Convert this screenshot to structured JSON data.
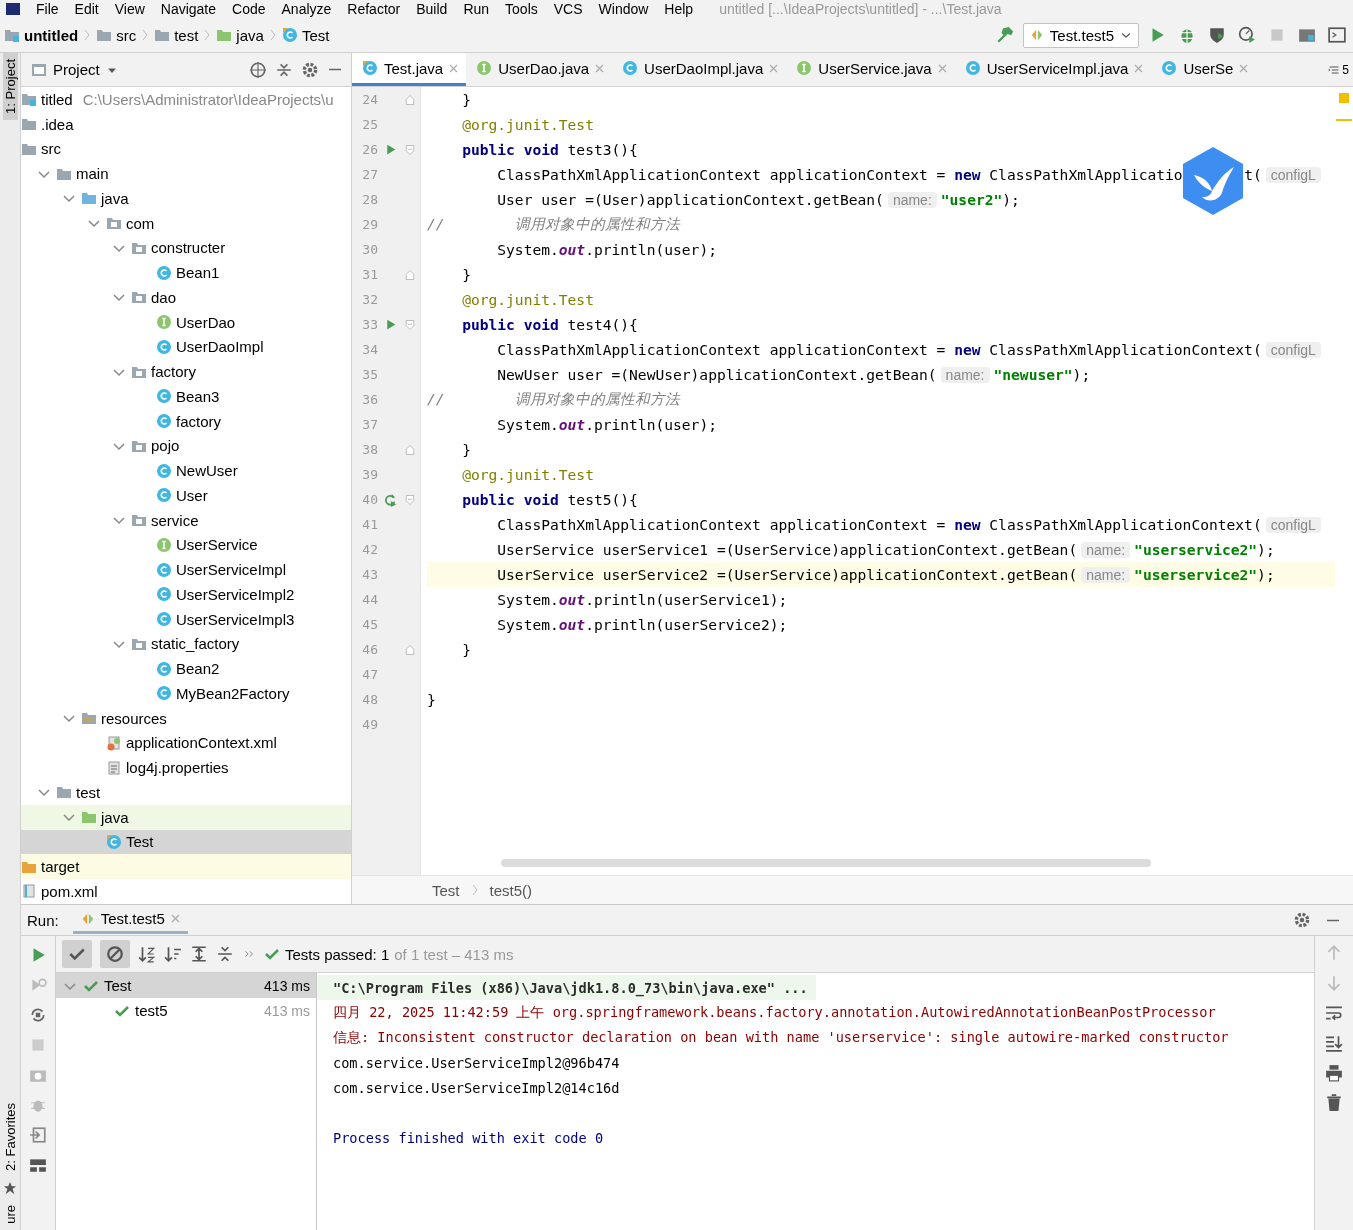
{
  "menu_bar": {
    "items": [
      "File",
      "Edit",
      "View",
      "Navigate",
      "Code",
      "Analyze",
      "Refactor",
      "Build",
      "Run",
      "Tools",
      "VCS",
      "Window",
      "Help"
    ],
    "title": "untitled [...\\IdeaProjects\\untitled] - ...\\Test.java"
  },
  "nav_bar": {
    "breadcrumbs": [
      {
        "label": "untitled",
        "kind": "module"
      },
      {
        "label": "src",
        "kind": "folder"
      },
      {
        "label": "test",
        "kind": "folder"
      },
      {
        "label": "java",
        "kind": "test-folder"
      },
      {
        "label": "Test",
        "kind": "test-class"
      }
    ],
    "run_config": "Test.test5"
  },
  "side_stripe": {
    "top": "1: Project",
    "bottom": "2: Favorites",
    "cut": "ure"
  },
  "project_panel": {
    "title": "Project",
    "tree": [
      {
        "label": "titled",
        "path": "C:\\Users\\Administrator\\IdeaProjects\\u",
        "kind": "module",
        "expanded": true,
        "selected": false,
        "children": [
          {
            "label": ".idea",
            "kind": "folder",
            "selected": false
          },
          {
            "label": "src",
            "kind": "folder",
            "expanded": true,
            "selected": false,
            "children": [
              {
                "label": "main",
                "kind": "folder",
                "expanded": true,
                "selected": false,
                "children": [
                  {
                    "label": "java",
                    "kind": "source-folder",
                    "expanded": true,
                    "selected": false,
                    "children": [
                      {
                        "label": "com",
                        "kind": "package",
                        "expanded": true,
                        "selected": false,
                        "children": [
                          {
                            "label": "constructer",
                            "kind": "package",
                            "expanded": true,
                            "selected": false,
                            "children": [
                              {
                                "label": "Bean1",
                                "kind": "class",
                                "selected": false
                              }
                            ]
                          },
                          {
                            "label": "dao",
                            "kind": "package",
                            "expanded": true,
                            "selected": false,
                            "children": [
                              {
                                "label": "UserDao",
                                "kind": "interface",
                                "selected": false
                              },
                              {
                                "label": "UserDaoImpl",
                                "kind": "class",
                                "selected": false
                              }
                            ]
                          },
                          {
                            "label": "factory",
                            "kind": "package",
                            "expanded": true,
                            "selected": false,
                            "children": [
                              {
                                "label": "Bean3",
                                "kind": "class",
                                "selected": false
                              },
                              {
                                "label": "factory",
                                "kind": "class",
                                "selected": false
                              }
                            ]
                          },
                          {
                            "label": "pojo",
                            "kind": "package",
                            "expanded": true,
                            "selected": false,
                            "children": [
                              {
                                "label": "NewUser",
                                "kind": "class",
                                "selected": false
                              },
                              {
                                "label": "User",
                                "kind": "class",
                                "selected": false
                              }
                            ]
                          },
                          {
                            "label": "service",
                            "kind": "package",
                            "expanded": true,
                            "selected": false,
                            "children": [
                              {
                                "label": "UserService",
                                "kind": "interface",
                                "selected": false
                              },
                              {
                                "label": "UserServiceImpl",
                                "kind": "class",
                                "selected": false
                              },
                              {
                                "label": "UserServiceImpl2",
                                "kind": "class",
                                "selected": false
                              },
                              {
                                "label": "UserServiceImpl3",
                                "kind": "class",
                                "selected": false
                              }
                            ]
                          },
                          {
                            "label": "static_factory",
                            "kind": "package",
                            "expanded": true,
                            "selected": false,
                            "children": [
                              {
                                "label": "Bean2",
                                "kind": "class",
                                "selected": false
                              },
                              {
                                "label": "MyBean2Factory",
                                "kind": "class",
                                "selected": false
                              }
                            ]
                          }
                        ]
                      }
                    ]
                  },
                  {
                    "label": "resources",
                    "kind": "resources-folder",
                    "expanded": true,
                    "selected": false,
                    "children": [
                      {
                        "label": "applicationContext.xml",
                        "kind": "xml",
                        "selected": false
                      },
                      {
                        "label": "log4j.properties",
                        "kind": "properties",
                        "selected": false
                      }
                    ]
                  }
                ]
              },
              {
                "label": "test",
                "kind": "folder",
                "expanded": true,
                "selected": false,
                "children": [
                  {
                    "label": "java",
                    "kind": "test-folder",
                    "expanded": true,
                    "selected": false,
                    "children": [
                      {
                        "label": "Test",
                        "kind": "test-class",
                        "selected": true
                      }
                    ]
                  }
                ]
              }
            ]
          },
          {
            "label": "target",
            "kind": "excluded-folder",
            "selected": false
          },
          {
            "label": "pom.xml",
            "kind": "pom",
            "selected": false
          }
        ]
      }
    ]
  },
  "editor": {
    "tabs": [
      {
        "label": "Test.java",
        "kind": "test-class",
        "selected": true
      },
      {
        "label": "UserDao.java",
        "kind": "interface",
        "selected": false
      },
      {
        "label": "UserDaoImpl.java",
        "kind": "class",
        "selected": false
      },
      {
        "label": "UserService.java",
        "kind": "interface",
        "selected": false
      },
      {
        "label": "UserServiceImpl.java",
        "kind": "class",
        "selected": false
      },
      {
        "label": "UserSe",
        "kind": "class",
        "selected": false
      }
    ],
    "overflow": "5",
    "lines": [
      {
        "number": "24",
        "kind": "member",
        "fold_marker": {
          "kind": "end"
        },
        "current": false,
        "tokens": [
          {
            "kind": "plain",
            "text": "}"
          }
        ]
      },
      {
        "number": "25",
        "kind": "member",
        "current": false,
        "tokens": [
          {
            "kind": "annotation",
            "text": "@org.junit.Test"
          }
        ]
      },
      {
        "number": "26",
        "kind": "member",
        "run_marker": {
          "kind": "run"
        },
        "fold_marker": {
          "kind": "start"
        },
        "current": false,
        "tokens": [
          {
            "kind": "keyword",
            "text": "public void"
          },
          {
            "kind": "plain",
            "text": " test3(){"
          }
        ]
      },
      {
        "number": "27",
        "kind": "body",
        "current": false,
        "tokens": [
          {
            "kind": "plain",
            "text": "ClassPathXmlApplicationContext applicationContext = "
          },
          {
            "kind": "keyword",
            "text": "new"
          },
          {
            "kind": "plain",
            "text": " ClassPathXmlApplicatio"
          },
          {
            "kind": "overlay-gap"
          },
          {
            "kind": "plain",
            "text": "t("
          },
          {
            "kind": "hint",
            "text": "configL"
          }
        ]
      },
      {
        "number": "28",
        "kind": "body",
        "current": false,
        "tokens": [
          {
            "kind": "plain",
            "text": "User user =(User)applicationContext.getBean("
          },
          {
            "kind": "hint",
            "text": "name:"
          },
          {
            "kind": "string",
            "text": "\"user2\""
          },
          {
            "kind": "plain",
            "text": ");"
          }
        ]
      },
      {
        "number": "29",
        "kind": "top",
        "current": false,
        "tokens": [
          {
            "kind": "comment",
            "text": "//        调用对象中的属性和方法"
          }
        ]
      },
      {
        "number": "30",
        "kind": "body",
        "current": false,
        "tokens": [
          {
            "kind": "plain",
            "text": "System."
          },
          {
            "kind": "field",
            "text": "out"
          },
          {
            "kind": "plain",
            "text": ".println(user);"
          }
        ]
      },
      {
        "number": "31",
        "kind": "member",
        "fold_marker": {
          "kind": "end"
        },
        "current": false,
        "tokens": [
          {
            "kind": "plain",
            "text": "}"
          }
        ]
      },
      {
        "number": "32",
        "kind": "member",
        "current": false,
        "tokens": [
          {
            "kind": "annotation",
            "text": "@org.junit.Test"
          }
        ]
      },
      {
        "number": "33",
        "kind": "member",
        "run_marker": {
          "kind": "run"
        },
        "fold_marker": {
          "kind": "start"
        },
        "current": false,
        "tokens": [
          {
            "kind": "keyword",
            "text": "public void"
          },
          {
            "kind": "plain",
            "text": " test4(){"
          }
        ]
      },
      {
        "number": "34",
        "kind": "body",
        "current": false,
        "tokens": [
          {
            "kind": "plain",
            "text": "ClassPathXmlApplicationContext applicationContext = "
          },
          {
            "kind": "keyword",
            "text": "new"
          },
          {
            "kind": "plain",
            "text": " ClassPathXmlApplicationContext("
          },
          {
            "kind": "hint",
            "text": "configL"
          }
        ]
      },
      {
        "number": "35",
        "kind": "body",
        "current": false,
        "tokens": [
          {
            "kind": "plain",
            "text": "NewUser user =(NewUser)applicationContext.getBean("
          },
          {
            "kind": "hint",
            "text": "name:"
          },
          {
            "kind": "string",
            "text": "\"newuser\""
          },
          {
            "kind": "plain",
            "text": ");"
          }
        ]
      },
      {
        "number": "36",
        "kind": "top",
        "current": false,
        "tokens": [
          {
            "kind": "comment",
            "text": "//        调用对象中的属性和方法"
          }
        ]
      },
      {
        "number": "37",
        "kind": "body",
        "current": false,
        "tokens": [
          {
            "kind": "plain",
            "text": "System."
          },
          {
            "kind": "field",
            "text": "out"
          },
          {
            "kind": "plain",
            "text": ".println(user);"
          }
        ]
      },
      {
        "number": "38",
        "kind": "member",
        "fold_marker": {
          "kind": "end"
        },
        "current": false,
        "tokens": [
          {
            "kind": "plain",
            "text": "}"
          }
        ]
      },
      {
        "number": "39",
        "kind": "member",
        "current": false,
        "tokens": [
          {
            "kind": "annotation",
            "text": "@org.junit.Test"
          }
        ]
      },
      {
        "number": "40",
        "kind": "member",
        "run_marker": {
          "kind": "rerun"
        },
        "fold_marker": {
          "kind": "start"
        },
        "current": false,
        "tokens": [
          {
            "kind": "keyword",
            "text": "public void"
          },
          {
            "kind": "plain",
            "text": " test5(){"
          }
        ]
      },
      {
        "number": "41",
        "kind": "body",
        "current": false,
        "tokens": [
          {
            "kind": "plain",
            "text": "ClassPathXmlApplicationContext applicationContext = "
          },
          {
            "kind": "keyword",
            "text": "new"
          },
          {
            "kind": "plain",
            "text": " ClassPathXmlApplicationContext("
          },
          {
            "kind": "hint",
            "text": "configL"
          }
        ]
      },
      {
        "number": "42",
        "kind": "body",
        "current": false,
        "tokens": [
          {
            "kind": "plain",
            "text": "UserService userService1 =(UserService)applicationContext.getBean("
          },
          {
            "kind": "hint",
            "text": "name:"
          },
          {
            "kind": "string",
            "text": "\"userservice2\""
          },
          {
            "kind": "plain",
            "text": ");"
          }
        ]
      },
      {
        "number": "43",
        "kind": "body",
        "current": true,
        "tokens": [
          {
            "kind": "plain",
            "text": "UserService userService2 =(UserService)applicationContext.getBean("
          },
          {
            "kind": "hint",
            "text": "name:"
          },
          {
            "kind": "string",
            "text": "\"userservice2\""
          },
          {
            "kind": "plain",
            "text": ");"
          }
        ]
      },
      {
        "number": "44",
        "kind": "body",
        "current": false,
        "tokens": [
          {
            "kind": "plain",
            "text": "System."
          },
          {
            "kind": "field",
            "text": "out"
          },
          {
            "kind": "plain",
            "text": ".println(userService1);"
          }
        ]
      },
      {
        "number": "45",
        "kind": "body",
        "current": false,
        "tokens": [
          {
            "kind": "plain",
            "text": "System."
          },
          {
            "kind": "field",
            "text": "out"
          },
          {
            "kind": "plain",
            "text": ".println(userService2);"
          }
        ]
      },
      {
        "number": "46",
        "kind": "member",
        "fold_marker": {
          "kind": "end"
        },
        "current": false,
        "tokens": [
          {
            "kind": "plain",
            "text": "}"
          }
        ]
      },
      {
        "number": "47",
        "kind": "top",
        "current": false
      },
      {
        "number": "48",
        "kind": "top",
        "current": false,
        "tokens": [
          {
            "kind": "plain",
            "text": "}"
          }
        ]
      },
      {
        "number": "49",
        "kind": "top",
        "current": false
      }
    ],
    "breadcrumbs": [
      "Test",
      "test5()"
    ]
  },
  "run_panel": {
    "label": "Run:",
    "tab": "Test.test5",
    "status": {
      "prefix": "Tests passed:",
      "passed": "1",
      "rest": "of 1 test – 413 ms"
    },
    "tests": [
      {
        "label": "Test",
        "time": "413 ms",
        "selected": true,
        "expanded": true,
        "children": [
          {
            "label": "test5",
            "time": "413 ms",
            "selected": false
          }
        ]
      }
    ],
    "console": [
      {
        "kind": "command",
        "text": "\"C:\\Program Files (x86)\\Java\\jdk1.8.0_73\\bin\\java.exe\" ..."
      },
      {
        "kind": "error",
        "text": "四月 22, 2025 11:42:59 上午 org.springframework.beans.factory.annotation.AutowiredAnnotationBeanPostProcessor"
      },
      {
        "kind": "error",
        "text": "信息: Inconsistent constructor declaration on bean with name 'userservice': single autowire-marked constructor"
      },
      {
        "kind": "output",
        "text": "com.service.UserServiceImpl2@96b474"
      },
      {
        "kind": "output",
        "text": "com.service.UserServiceImpl2@14c16d"
      },
      {
        "kind": "exit",
        "text": "Process finished with exit code 0"
      }
    ]
  }
}
